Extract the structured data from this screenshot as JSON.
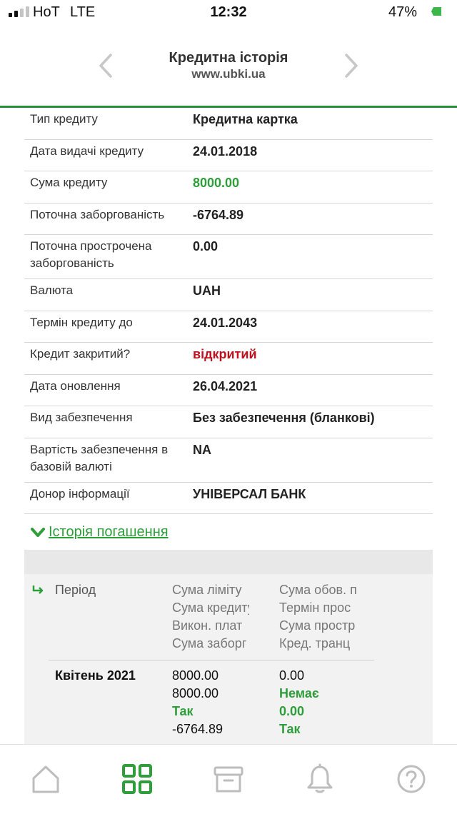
{
  "status_bar": {
    "carrier": "HoT",
    "network": "LTE",
    "time": "12:32",
    "battery": "47%"
  },
  "header": {
    "title": "Кредитна історія",
    "subtitle": "www.ubki.ua"
  },
  "details": [
    {
      "label": "Тип кредиту",
      "value": "Кредитна картка"
    },
    {
      "label": "Дата видачі кредиту",
      "value": "24.01.2018"
    },
    {
      "label": "Сума кредиту",
      "value": "8000.00"
    },
    {
      "label": "Поточна заборгованість",
      "value": "-6764.89"
    },
    {
      "label": "Поточна прострочена заборгованість",
      "value": "0.00"
    },
    {
      "label": "Валюта",
      "value": "UAH"
    },
    {
      "label": "Термін кредиту до",
      "value": "24.01.2043"
    },
    {
      "label": "Кредит закритий?",
      "value": "відкритий"
    },
    {
      "label": "Дата оновлення",
      "value": "26.04.2021"
    },
    {
      "label": "Вид забезпечення",
      "value": "Без забезпечення (бланкові)"
    },
    {
      "label": "Вартість забезпечення в базовій валюті",
      "value": "NA"
    },
    {
      "label": "Донор інформації",
      "value": "УНІВЕРСАЛ БАНК"
    }
  ],
  "history_link": "Історія погашення",
  "history": {
    "period_header": "Період",
    "col_a_headers": [
      "Сума ліміту",
      "Сума кредиту",
      "Викон. плат",
      "Сума заборг"
    ],
    "col_b_headers": [
      "Сума обов. п",
      "Термін прос",
      "Сума простр",
      "Кред. транц"
    ],
    "rows": [
      {
        "period": "Квітень 2021",
        "col_a": [
          "8000.00",
          "8000.00",
          "Так",
          "-6764.89"
        ],
        "col_b": [
          "0.00",
          "Немає",
          "0.00",
          "Так"
        ]
      }
    ]
  },
  "colors": {
    "accent_green": "#2e9e3a",
    "header_line": "#27913a",
    "open_red": "#c0101c"
  },
  "tab_bar": {
    "icons": [
      "home-icon",
      "grid-icon",
      "archive-icon",
      "bell-icon",
      "help-icon"
    ],
    "active": "grid-icon"
  }
}
